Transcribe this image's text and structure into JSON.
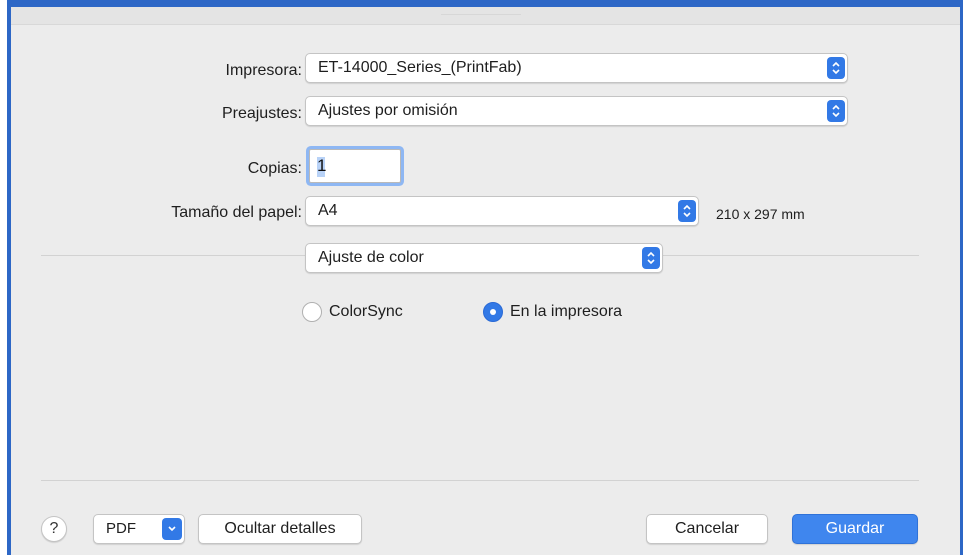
{
  "printer": {
    "label": "Impresora:",
    "value": "ET-14000_Series_(PrintFab)"
  },
  "presets": {
    "label": "Preajustes:",
    "value": "Ajustes por omisión"
  },
  "copies": {
    "label": "Copias:",
    "value": "1"
  },
  "paper_size": {
    "label": "Tamaño del papel:",
    "value": "A4",
    "dimensions": "210 x 297 mm"
  },
  "section_menu": {
    "value": "Ajuste de color"
  },
  "color_options": [
    {
      "label": "ColorSync",
      "selected": false
    },
    {
      "label": "En la impresora",
      "selected": true
    }
  ],
  "footer": {
    "help_label": "?",
    "pdf_label": "PDF",
    "hide_details_label": "Ocultar detalles",
    "cancel_label": "Cancelar",
    "save_label": "Guardar"
  },
  "colors": {
    "accent": "#3279e6",
    "primary_button": "#3f86ee",
    "window_frame": "#2d67c6",
    "dialog_bg": "#ececec"
  },
  "icons": {
    "popup_stepper": "up-down-chevron-icon",
    "pdf_dropdown": "chevron-down-icon"
  }
}
